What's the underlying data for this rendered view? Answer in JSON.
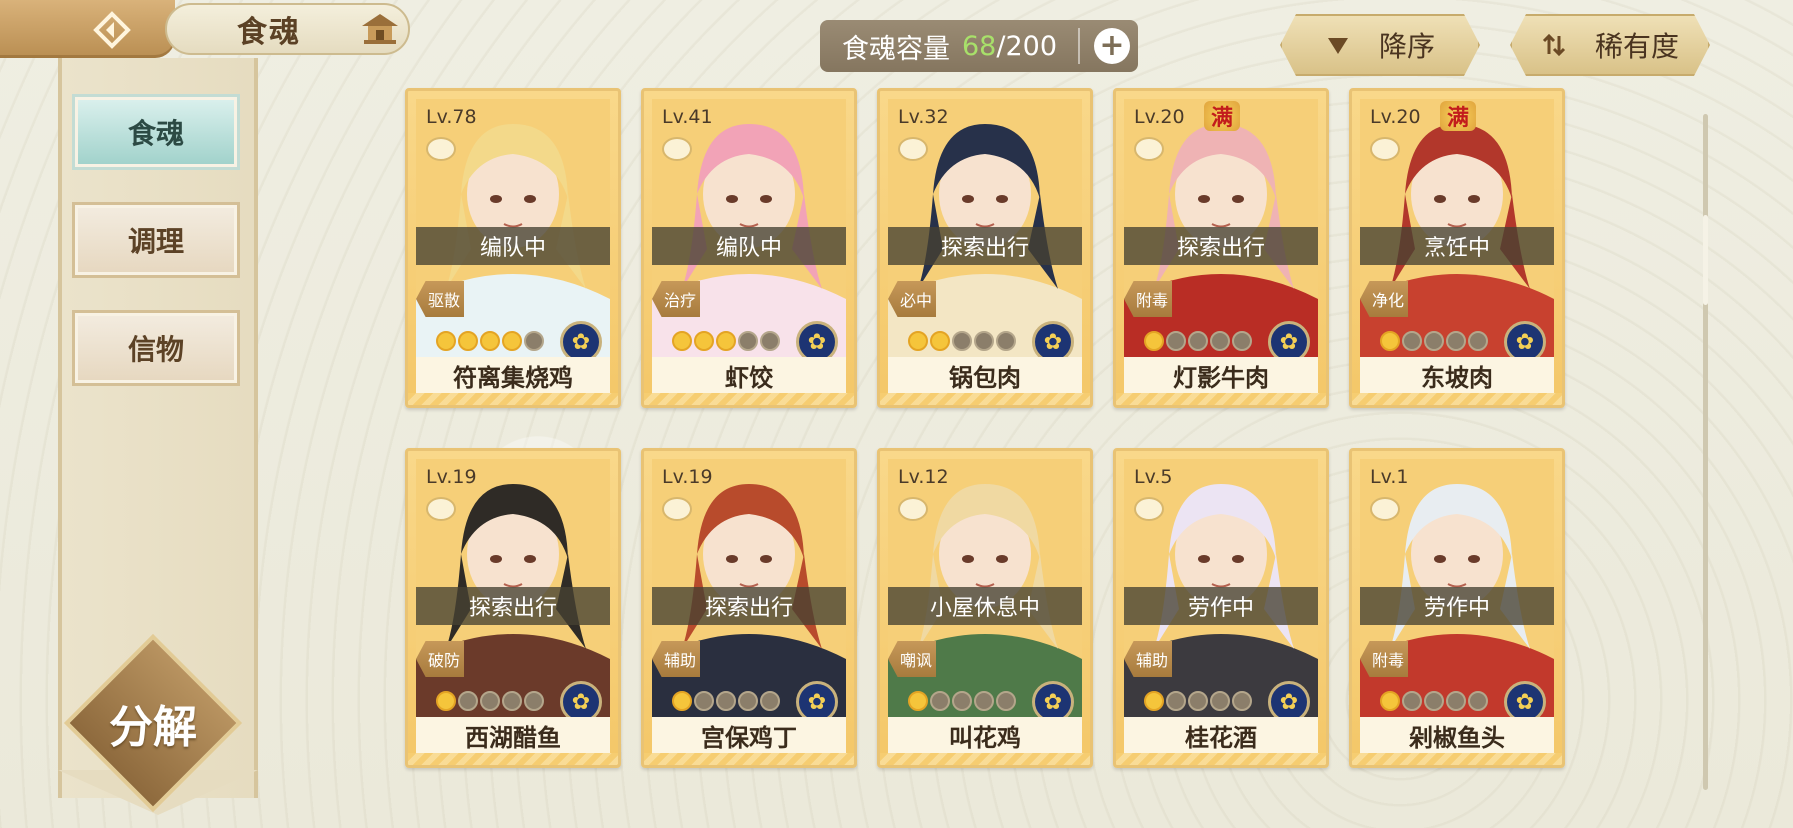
{
  "header": {
    "title": "食魂",
    "back_icon": "back-arrow-icon",
    "home_icon": "pavilion-icon"
  },
  "capacity": {
    "label": "食魂容量",
    "current": "68",
    "separator": "/",
    "max": "200",
    "add_label": "+"
  },
  "sort": {
    "order_label": "降序",
    "order_icon": "triangle-down-icon",
    "rarity_label": "稀有度",
    "rarity_icon": "swap-icon"
  },
  "sidebar": {
    "items": [
      {
        "label": "食魂",
        "active": true
      },
      {
        "label": "调理",
        "active": false
      },
      {
        "label": "信物",
        "active": false
      }
    ],
    "decompose_label": "分解"
  },
  "full_badge_text": "满",
  "cards": [
    {
      "level": "Lv.78",
      "status": "编队中",
      "role": "驱散",
      "name": "符离集烧鸡",
      "stars": 4,
      "full": false,
      "hair": "#f3d98a",
      "outfit": "#e9f3f5"
    },
    {
      "level": "Lv.41",
      "status": "编队中",
      "role": "治疗",
      "name": "虾饺",
      "stars": 3,
      "full": false,
      "hair": "#f2a3b7",
      "outfit": "#f8e2ea"
    },
    {
      "level": "Lv.32",
      "status": "探索出行",
      "role": "必中",
      "name": "锅包肉",
      "stars": 2,
      "full": false,
      "hair": "#27314a",
      "outfit": "#f3e6c4"
    },
    {
      "level": "Lv.20",
      "status": "探索出行",
      "role": "附毒",
      "name": "灯影牛肉",
      "stars": 1,
      "full": true,
      "hair": "#efb3b4",
      "outfit": "#b92d25"
    },
    {
      "level": "Lv.20",
      "status": "烹饪中",
      "role": "净化",
      "name": "东坡肉",
      "stars": 1,
      "full": true,
      "hair": "#b2372b",
      "outfit": "#c8412f"
    },
    {
      "level": "Lv.19",
      "status": "探索出行",
      "role": "破防",
      "name": "西湖醋鱼",
      "stars": 1,
      "full": false,
      "hair": "#2f2b26",
      "outfit": "#6b3a2a"
    },
    {
      "level": "Lv.19",
      "status": "探索出行",
      "role": "辅助",
      "name": "宫保鸡丁",
      "stars": 1,
      "full": false,
      "hair": "#b84b2c",
      "outfit": "#2a2f3f"
    },
    {
      "level": "Lv.12",
      "status": "小屋休息中",
      "role": "嘲讽",
      "name": "叫花鸡",
      "stars": 1,
      "full": false,
      "hair": "#f0d9a2",
      "outfit": "#4f7a49"
    },
    {
      "level": "Lv.5",
      "status": "劳作中",
      "role": "辅助",
      "name": "桂花酒",
      "stars": 1,
      "full": false,
      "hair": "#ece4f3",
      "outfit": "#3c3a3f"
    },
    {
      "level": "Lv.1",
      "status": "劳作中",
      "role": "附毒",
      "name": "剁椒鱼头",
      "stars": 1,
      "full": false,
      "hair": "#e8edf1",
      "outfit": "#c2392c"
    }
  ]
}
